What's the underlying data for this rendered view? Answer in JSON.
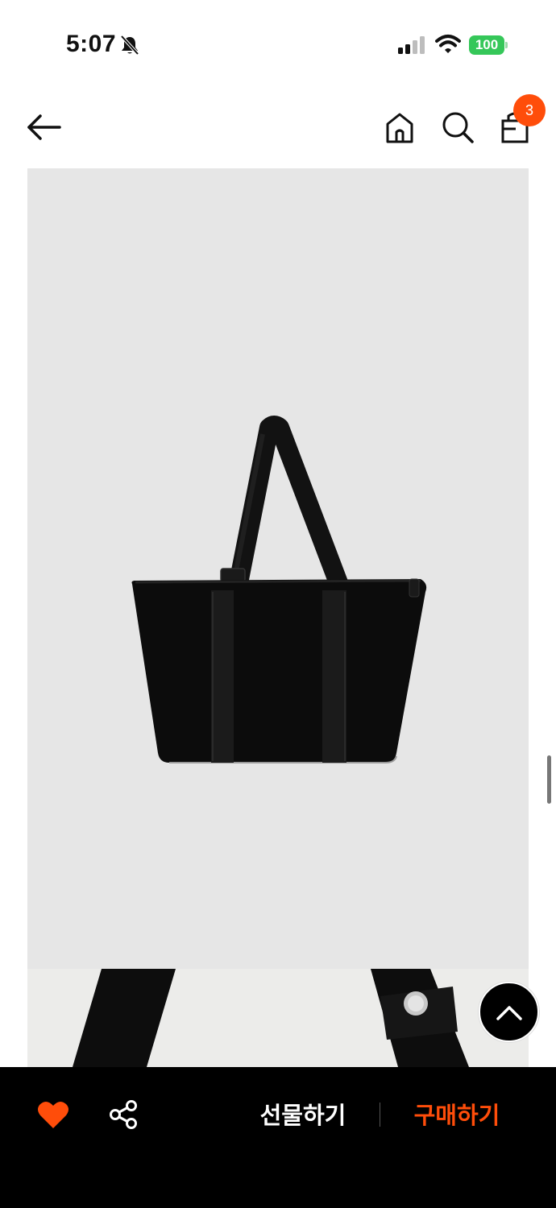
{
  "status_bar": {
    "time": "5:07",
    "battery": "100",
    "battery_color": "#35c759"
  },
  "header": {
    "icons": [
      "back-arrow-icon",
      "home-icon",
      "search-icon",
      "shopping-bag-icon"
    ],
    "cart_count": "3",
    "badge_color": "#ff4d0a"
  },
  "product": {
    "images": [
      "black-tote-bag-photo",
      "tote-strap-detail-photo"
    ]
  },
  "bottom_bar": {
    "gift_label": "선물하기",
    "buy_label": "구매하기",
    "accent": "#ff4d0a",
    "icons": [
      "heart-icon",
      "share-icon"
    ]
  },
  "scroll_top_icon": "chevron-up-icon"
}
